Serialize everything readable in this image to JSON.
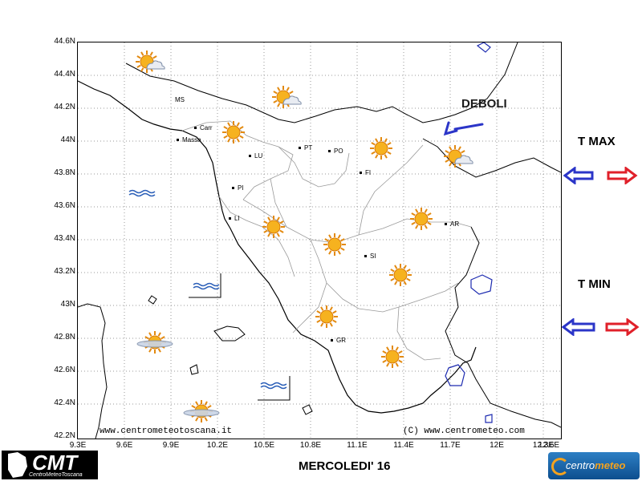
{
  "map": {
    "lat_labels": [
      "44.6N",
      "44.4N",
      "44.2N",
      "44N",
      "43.8N",
      "43.6N",
      "43.4N",
      "43.2N",
      "43N",
      "42.8N",
      "42.6N",
      "42.4N",
      "42.2N"
    ],
    "lon_labels": [
      "9.3E",
      "9.6E",
      "9.9E",
      "10.2E",
      "10.5E",
      "10.8E",
      "11.1E",
      "11.4E",
      "11.7E",
      "12E",
      "12.3E",
      "12.6E"
    ],
    "cities": [
      {
        "code": "MS"
      },
      {
        "code": "Carr"
      },
      {
        "code": "Massa"
      },
      {
        "code": "LU"
      },
      {
        "code": "PT"
      },
      {
        "code": "PO"
      },
      {
        "code": "FI"
      },
      {
        "code": "PI"
      },
      {
        "code": "LI"
      },
      {
        "code": "AR"
      },
      {
        "code": "SI"
      },
      {
        "code": "GR"
      }
    ],
    "weather_icons": [
      {
        "type": "sun-cloud-icon"
      },
      {
        "type": "sun-cloud-icon"
      },
      {
        "type": "sun-icon"
      },
      {
        "type": "sun-icon"
      },
      {
        "type": "sun-cloud-icon"
      },
      {
        "type": "sun-icon"
      },
      {
        "type": "sun-icon"
      },
      {
        "type": "sun-icon"
      },
      {
        "type": "sun-icon"
      },
      {
        "type": "sun-icon"
      },
      {
        "type": "sun-icon"
      },
      {
        "type": "sun-haze-icon"
      },
      {
        "type": "sun-haze-icon"
      }
    ],
    "sea_icons": [
      {
        "type": "calm-sea-icon"
      },
      {
        "type": "calm-sea-icon"
      },
      {
        "type": "calm-sea-icon"
      }
    ],
    "wind_label": "DEBOLI",
    "credit_left": "www.centrometeotoscana.it",
    "credit_right": "(C) www.centrometeo.com"
  },
  "legend": {
    "tmax_label": "T MAX",
    "tmin_label": "T MIN",
    "cold_color": "#2b35c8",
    "warm_color": "#e0202a"
  },
  "footer": {
    "date": "MERCOLEDI' 16",
    "logo_left": "CMT",
    "logo_left_sub": "CentroMeteoToscana",
    "logo_right_a": "centro",
    "logo_right_b": "meteo"
  }
}
